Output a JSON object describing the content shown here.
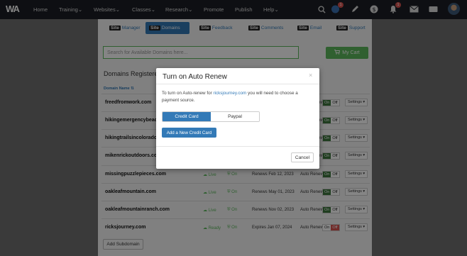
{
  "nav": {
    "logo": "WA",
    "links": [
      "Home",
      "Training",
      "Websites",
      "Classes",
      "Research",
      "Promote",
      "Publish",
      "Help"
    ],
    "icons": {
      "search": "search-icon",
      "community": "chat-icon",
      "community_badge": "1",
      "pencil": "pencil-icon",
      "credits": "dollar-icon",
      "notifications": "bell-icon",
      "notifications_badge": "1",
      "mail": "mail-icon",
      "keyboard": "keyboard-icon"
    }
  },
  "subnav": [
    {
      "site": "Site",
      "label": "Manager"
    },
    {
      "site": "Site",
      "label": "Domains"
    },
    {
      "site": "Site",
      "label": "Feedback"
    },
    {
      "site": "Site",
      "label": "Comments"
    },
    {
      "site": "Site",
      "label": "Email"
    },
    {
      "site": "Site",
      "label": "Support"
    }
  ],
  "search": {
    "placeholder": "Search for Available Domains here..."
  },
  "cart": {
    "label": "My Cart"
  },
  "domains": {
    "title": "Domains Registered",
    "column_domain": "Domain Name",
    "rows": [
      {
        "name": "freedfromwork.com",
        "status": "",
        "ssl": "",
        "renews": "",
        "auto": "Auto Renew",
        "on": "On",
        "off": "Off",
        "settings": "Settings"
      },
      {
        "name": "hikingemergencybeacon",
        "status": "",
        "ssl": "",
        "renews": "",
        "auto": "Auto Renew",
        "on": "On",
        "off": "Off",
        "settings": "Settings"
      },
      {
        "name": "hikingtrailsincolorado.",
        "status": "",
        "ssl": "",
        "renews": "",
        "auto": "Auto Renew",
        "on": "On",
        "off": "Off",
        "settings": "Settings"
      },
      {
        "name": "mikenrickoutdoors.com",
        "status": "",
        "ssl": "",
        "renews": "",
        "auto": "Auto Renew",
        "on": "On",
        "off": "Off",
        "settings": "Settings"
      },
      {
        "name": "missingpuzzlepieces.com",
        "status": "Live",
        "ssl": "On",
        "renews": "Renews Feb 12, 2023",
        "auto": "Auto Renew",
        "on": "On",
        "off": "Off",
        "settings": "Settings"
      },
      {
        "name": "oakleafmountain.com",
        "status": "Live",
        "ssl": "On",
        "renews": "Renews May 01, 2023",
        "auto": "Auto Renew",
        "on": "On",
        "off": "Off",
        "settings": "Settings"
      },
      {
        "name": "oakleafmountainranch.com",
        "status": "Live",
        "ssl": "On",
        "renews": "Renews Nov 02, 2023",
        "auto": "Auto Renew",
        "on": "On",
        "off": "Off",
        "settings": "Settings"
      },
      {
        "name": "ricksjourney.com",
        "status": "Ready",
        "ssl": "On",
        "renews": "Expires Jan 07, 2024",
        "auto": "Auto Renew",
        "on": "On",
        "off": "Off",
        "settings": "Settings"
      }
    ],
    "add_subdomain": "Add Subdomain"
  },
  "modal": {
    "title": "Turn on Auto Renew",
    "close": "×",
    "text_before": "To turn on Auto-renew for",
    "domain": "ricksjourney.com",
    "text_after": "you will need to choose a payment source.",
    "seg_credit": "Credit Card",
    "seg_paypal": "Paypal",
    "add_card": "Add a New Credit Card",
    "cancel": "Cancel"
  },
  "colors": {
    "nav_bg": "#1b1e25",
    "primary": "#337ab7",
    "success": "#5cb85c",
    "danger": "#d9534f"
  }
}
